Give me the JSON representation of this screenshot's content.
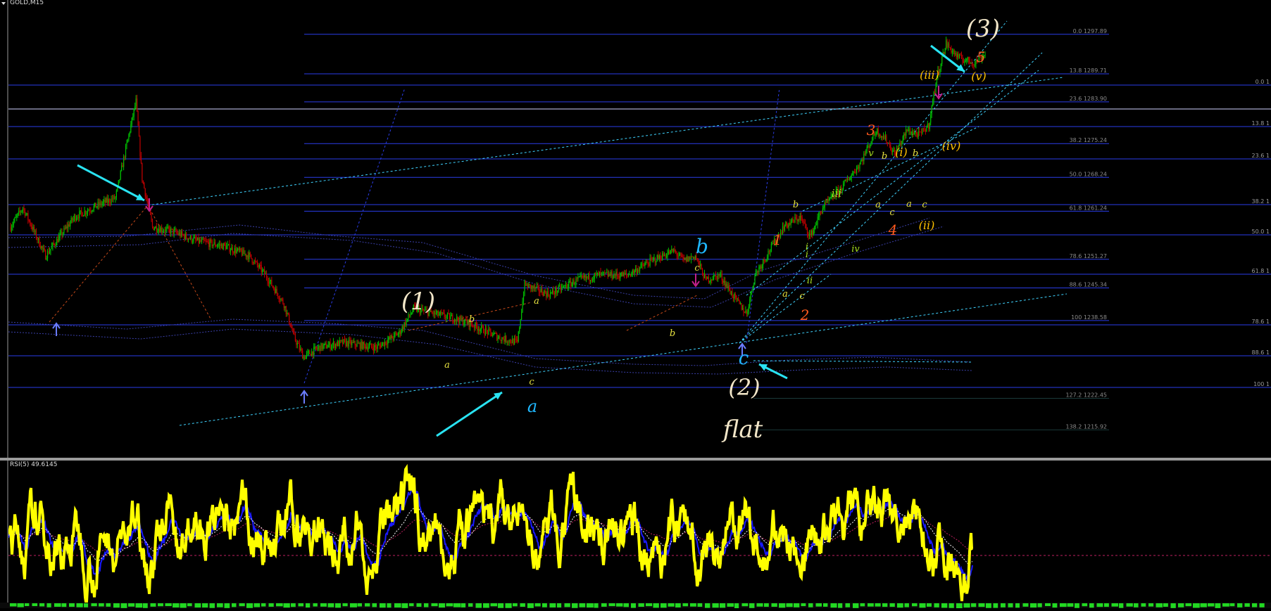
{
  "window": {
    "title": "GOLD,M15",
    "colors": {
      "background": "#000000",
      "frame": "#9a9a9a"
    }
  },
  "chart_data": [
    {
      "type": "line",
      "name": "main-price-panel",
      "symbol": "GOLD",
      "timeframe": "M15",
      "ylim": [
        1210,
        1305
      ],
      "candles": {
        "anchors": [
          [
            0,
            1258
          ],
          [
            12,
            1262
          ],
          [
            25,
            1256
          ],
          [
            34,
            1252
          ],
          [
            48,
            1256
          ],
          [
            62,
            1260
          ],
          [
            80,
            1262
          ],
          [
            102,
            1264
          ],
          [
            110,
            1272
          ],
          [
            122,
            1284
          ],
          [
            128,
            1268
          ],
          [
            138,
            1258
          ],
          [
            158,
            1257
          ],
          [
            182,
            1255
          ],
          [
            208,
            1254
          ],
          [
            232,
            1252
          ],
          [
            248,
            1248
          ],
          [
            266,
            1242
          ],
          [
            276,
            1235
          ],
          [
            285,
            1231
          ],
          [
            300,
            1233
          ],
          [
            324,
            1234
          ],
          [
            356,
            1233
          ],
          [
            378,
            1236
          ],
          [
            392,
            1241
          ],
          [
            412,
            1240
          ],
          [
            432,
            1239
          ],
          [
            446,
            1238
          ],
          [
            476,
            1235
          ],
          [
            493,
            1234
          ],
          [
            500,
            1246
          ],
          [
            524,
            1244
          ],
          [
            552,
            1247
          ],
          [
            572,
            1248
          ],
          [
            600,
            1248
          ],
          [
            624,
            1251
          ],
          [
            645,
            1253
          ],
          [
            655,
            1251
          ],
          [
            666,
            1252
          ],
          [
            676,
            1247
          ],
          [
            690,
            1248
          ],
          [
            705,
            1243
          ],
          [
            716,
            1240
          ],
          [
            724,
            1248
          ],
          [
            738,
            1253
          ],
          [
            752,
            1258
          ],
          [
            768,
            1260
          ],
          [
            778,
            1256
          ],
          [
            790,
            1262
          ],
          [
            808,
            1266
          ],
          [
            826,
            1271
          ],
          [
            842,
            1278
          ],
          [
            852,
            1276
          ],
          [
            860,
            1273
          ],
          [
            872,
            1278
          ],
          [
            884,
            1277
          ],
          [
            893,
            1279
          ],
          [
            901,
            1289
          ],
          [
            910,
            1296
          ],
          [
            922,
            1293
          ],
          [
            938,
            1292
          ],
          [
            948,
            1294
          ]
        ],
        "up_color": "#00c000",
        "down_color": "#c00000"
      },
      "fib_retracement": {
        "line_color": "#2a3de8",
        "levels": [
          {
            "price": 1297.89,
            "label": "0.0 1297.89"
          },
          {
            "price": 1289.71,
            "label": "13.8 1289.71"
          },
          {
            "price": 1283.9,
            "label": "23.6 1283.90"
          },
          {
            "price": 1275.24,
            "label": "38.2 1275.24"
          },
          {
            "price": 1268.24,
            "label": "50.0 1268.24"
          },
          {
            "price": 1261.24,
            "label": "61.8 1261.24"
          },
          {
            "price": 1251.27,
            "label": "78.6 1251.27"
          },
          {
            "price": 1245.34,
            "label": "88.6 1245.34"
          },
          {
            "price": 1238.58,
            "label": "100 1238.58"
          },
          {
            "price": 1222.45,
            "label": "127.2 1222.45"
          },
          {
            "price": 1215.92,
            "label": "138.2 1215.92"
          }
        ]
      },
      "fib_right_labels": [
        "0.0 1",
        "13.8 1",
        "23.6 1",
        "38.2 1",
        "50.0 1",
        "61.8 1",
        "78.6 1",
        "88.6 1",
        "100 1"
      ],
      "wave_labels": [
        {
          "text": "(1)",
          "color": "#f2e6c8"
        },
        {
          "text": "(2)",
          "color": "#f2e6c8"
        },
        {
          "text": "(3)",
          "color": "#f2e6c8"
        },
        {
          "text": "flat",
          "color": "#f2e6c8"
        },
        {
          "text": "a",
          "color": "#1fb8ff"
        },
        {
          "text": "b",
          "color": "#1fb8ff"
        },
        {
          "text": "c",
          "color": "#1fb8ff"
        },
        {
          "text": "1",
          "color": "#ff5a1e"
        },
        {
          "text": "2",
          "color": "#ff5a1e"
        },
        {
          "text": "3",
          "color": "#ff5a1e"
        },
        {
          "text": "4",
          "color": "#ff5a1e"
        },
        {
          "text": "5",
          "color": "#ff5a1e"
        },
        {
          "text": "(i)",
          "color": "#ffc000"
        },
        {
          "text": "(ii)",
          "color": "#ffc000"
        },
        {
          "text": "(iii)",
          "color": "#ffc000"
        },
        {
          "text": "(iv)",
          "color": "#ffc000"
        },
        {
          "text": "(v)",
          "color": "#ffc000"
        },
        {
          "text": "i",
          "color": "#a8e020"
        },
        {
          "text": "ii",
          "color": "#a8e020"
        },
        {
          "text": "iii",
          "color": "#a8e020"
        },
        {
          "text": "iv",
          "color": "#a8e020"
        },
        {
          "text": "v",
          "color": "#a8e020"
        },
        {
          "text": "a",
          "color": "#e6e240"
        },
        {
          "text": "b",
          "color": "#e6e240"
        },
        {
          "text": "c",
          "color": "#e6e240"
        }
      ]
    },
    {
      "type": "line",
      "name": "rsi-panel",
      "title": "RSI(5) 49.6145",
      "ylim": [
        0,
        100
      ],
      "series_colors": {
        "rsi": "#ffff00",
        "rsi_slow": "#1a1aff",
        "signal_white": "#ffffff",
        "signal_red": "#c02060"
      }
    }
  ]
}
